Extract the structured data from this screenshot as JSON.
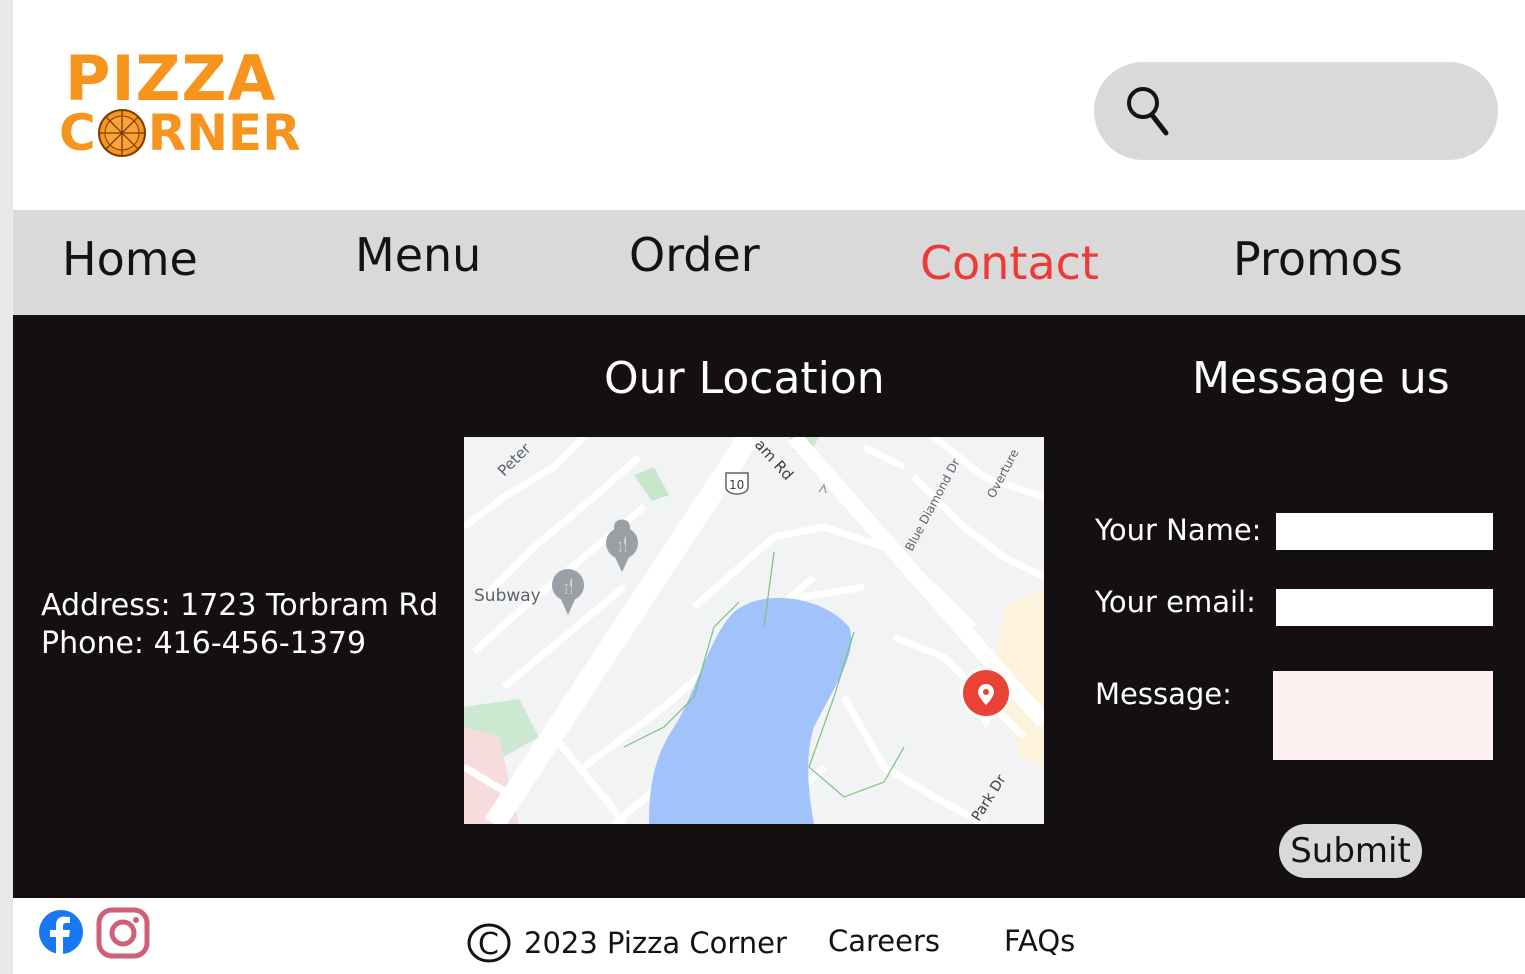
{
  "brand": {
    "logo_line1": "PIZZA",
    "logo_line2_prefix": "C",
    "logo_line2_suffix": "RNER",
    "color": "#f7941d"
  },
  "search": {
    "placeholder": "",
    "value": ""
  },
  "nav": {
    "items": [
      {
        "label": "Home"
      },
      {
        "label": "Menu"
      },
      {
        "label": "Order"
      },
      {
        "label": "Contact",
        "active": true
      },
      {
        "label": "Promos"
      }
    ],
    "active_color": "#ee3a37"
  },
  "contact": {
    "address": "Address: 1723 Torbram Rd",
    "phone": "Phone: 416-456-1379"
  },
  "location": {
    "title": "Our Location",
    "map_labels": {
      "road1": "Peter",
      "road2": "am Rd",
      "route": "10",
      "street3": "Blue Diamond Dr",
      "street4": "Overture",
      "place": "Subway",
      "street5": "Park Dr"
    }
  },
  "message_form": {
    "title": "Message us",
    "name_label": "Your Name:",
    "email_label": "Your email:",
    "message_label": "Message:",
    "name_value": "",
    "email_value": "",
    "message_value": "",
    "submit_label": "Submit"
  },
  "footer": {
    "copyright": "2023 Pizza Corner",
    "copyright_symbol": "C",
    "careers": "Careers",
    "faqs": "FAQs",
    "social": [
      "facebook-icon",
      "instagram-icon"
    ]
  }
}
